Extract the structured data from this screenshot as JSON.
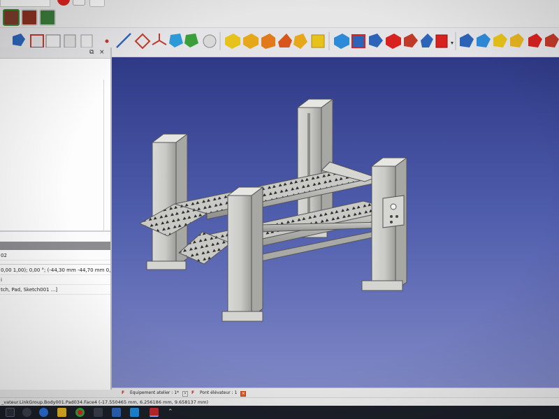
{
  "toolbar": {
    "workbench_label": "",
    "colors": {
      "red": "#d8221f",
      "blue": "#2d64b8",
      "yellow": "#e6b320",
      "green": "#3a9e3a"
    }
  },
  "left_panel": {
    "float_glyph": "⧉",
    "close_glyph": "×",
    "properties": {
      "rows": [
        "02",
        "0,00 1,00); 0,00 °; (-44,30 mm   -44,70 mm  0,00...",
        "i",
        "tch, Pad, Sketch001 ...]"
      ]
    }
  },
  "doc_tabs": [
    {
      "label": "Equipement atelier : 1*",
      "active": false
    },
    {
      "label": "Pont élévateur : 1",
      "active": true
    }
  ],
  "status_bar": {
    "text": "_vateur.LinkGroup.Body001.Pad034.Face4 (-17.550465 mm, 6.256186 mm, 9.658137 mm)"
  },
  "taskbar": {
    "icons": [
      "start-icon",
      "search-icon",
      "task-view-icon",
      "edge-icon",
      "file-explorer-icon",
      "chrome-icon",
      "app-icon",
      "app-icon-2",
      "app-icon-3",
      "freecad-icon",
      "chevron-icon"
    ]
  }
}
